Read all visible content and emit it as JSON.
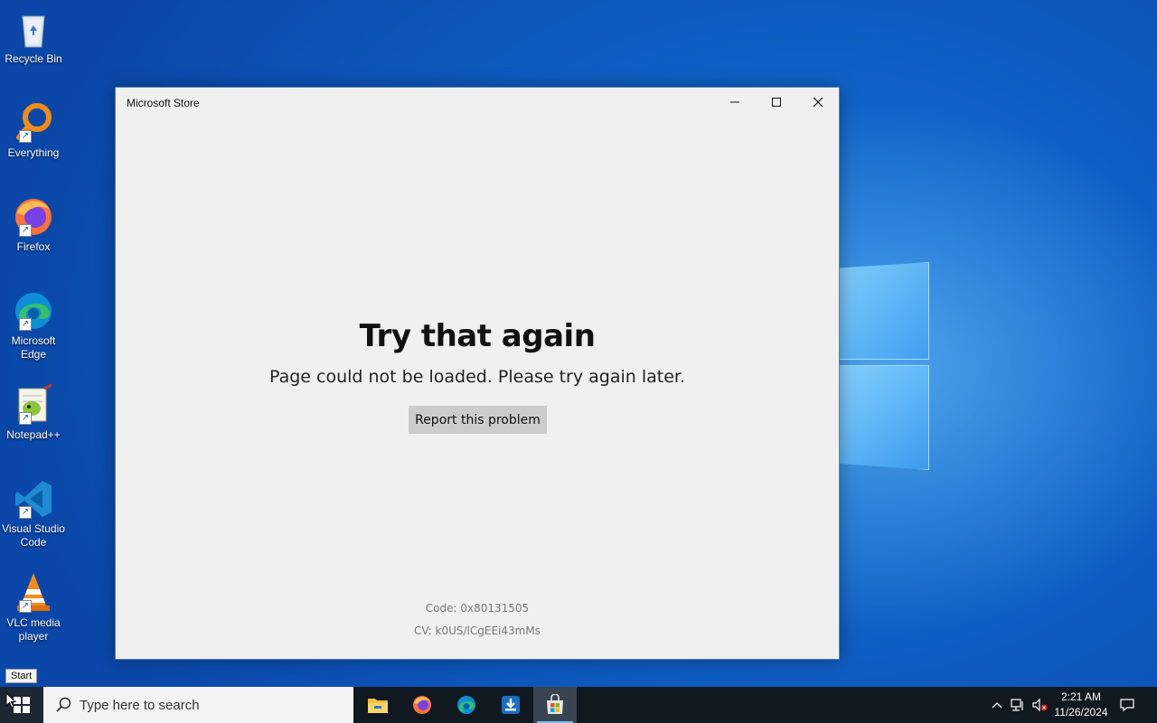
{
  "desktop": {
    "icons": [
      {
        "label": "Recycle Bin",
        "icon": "recycle-bin-icon"
      },
      {
        "label": "Everything",
        "icon": "everything-search-icon"
      },
      {
        "label": "Firefox",
        "icon": "firefox-icon"
      },
      {
        "label": "Microsoft Edge",
        "icon": "edge-icon"
      },
      {
        "label": "Notepad++",
        "icon": "notepad-plus-plus-icon"
      },
      {
        "label": "Visual Studio Code",
        "icon": "vscode-icon"
      },
      {
        "label": "VLC media player",
        "icon": "vlc-icon"
      }
    ]
  },
  "window": {
    "title": "Microsoft Store",
    "error_title": "Try that again",
    "error_message": "Page could not be loaded. Please try again later.",
    "report_button": "Report this problem",
    "code": "Code: 0x80131505",
    "cv": "CV: k0US/lCgEEi43mMs"
  },
  "tooltip": {
    "text": "Start"
  },
  "taskbar": {
    "search_placeholder": "Type here to search",
    "apps": [
      "file-explorer-icon",
      "firefox-icon",
      "edge-icon",
      "download-app-icon",
      "microsoft-store-icon"
    ],
    "clock": {
      "time": "2:21 AM",
      "date": "11/26/2024"
    }
  }
}
